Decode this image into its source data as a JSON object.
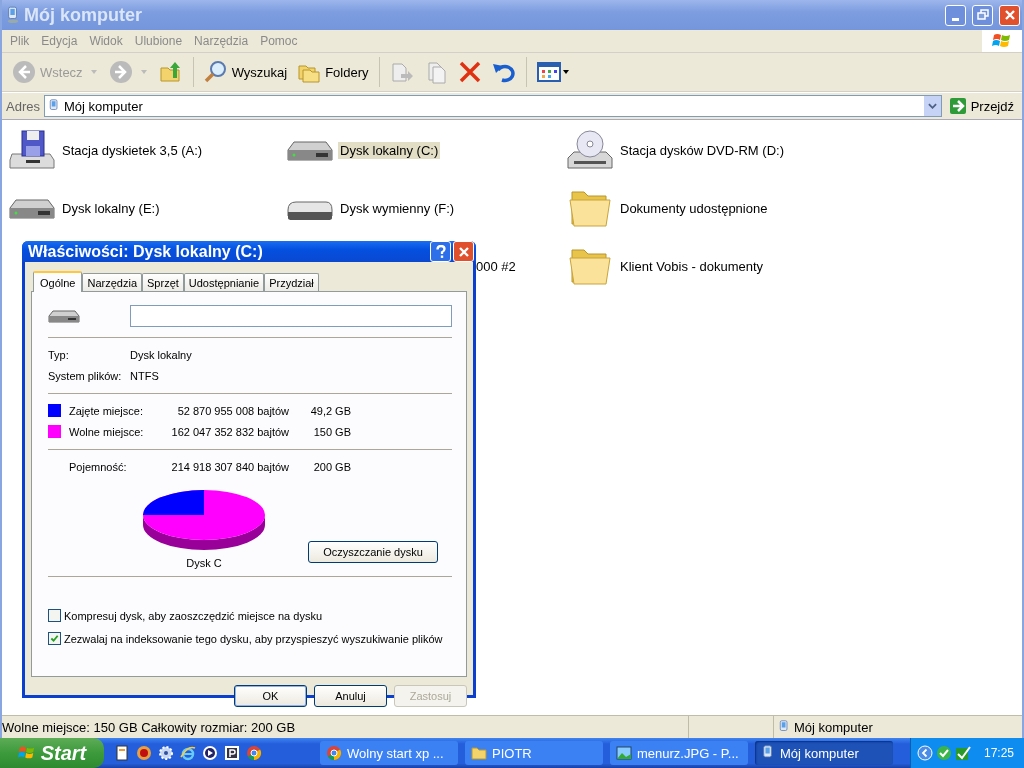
{
  "window": {
    "title": "Mój komputer"
  },
  "menu": [
    "Plik",
    "Edycja",
    "Widok",
    "Ulubione",
    "Narzędzia",
    "Pomoc"
  ],
  "toolbar": {
    "back": "Wstecz",
    "search": "Wyszukaj",
    "folders": "Foldery"
  },
  "address": {
    "label": "Adres",
    "value": "Mój komputer",
    "go": "Przejdź"
  },
  "items": [
    {
      "kind": "floppy",
      "label": "Stacja dyskietek 3,5 (A:)",
      "selected": false
    },
    {
      "kind": "disk",
      "label": "Dysk lokalny (C:)",
      "selected": true
    },
    {
      "kind": "dvd",
      "label": "Stacja dysków DVD-RM (D:)",
      "selected": false
    },
    {
      "kind": "disk",
      "label": "Dysk lokalny (E:)",
      "selected": false
    },
    {
      "kind": "removable",
      "label": "Dysk wymienny (F:)",
      "selected": false
    },
    {
      "kind": "folder",
      "label": "Dokumenty udostępnione",
      "selected": false
    },
    {
      "kind": "covered"
    },
    {
      "kind": "clipped",
      "label": "000 #2",
      "selected": false
    },
    {
      "kind": "folder",
      "label": "Klient Vobis - dokumenty",
      "selected": false
    }
  ],
  "dialog": {
    "title": "Właściwości: Dysk lokalny (C:)",
    "tabs": [
      {
        "label": "Ogólne",
        "selected": true
      },
      {
        "label": "Narzędzia",
        "selected": false
      },
      {
        "label": "Sprzęt",
        "selected": false
      },
      {
        "label": "Udostępnianie",
        "selected": false
      },
      {
        "label": "Przydział",
        "selected": false
      }
    ],
    "info": [
      {
        "label": "Typ:",
        "value": "Dysk lokalny"
      },
      {
        "label": "System plików:",
        "value": "NTFS"
      }
    ],
    "usage": [
      {
        "label": "Zajęte miejsce:",
        "color": "#0000ff",
        "bytes": "52 870 955 008 bajtów",
        "size": "49,2 GB"
      },
      {
        "label": "Wolne miejsce:",
        "color": "#ff00ff",
        "bytes": "162 047 352 832 bajtów",
        "size": "150 GB"
      }
    ],
    "capacity": {
      "label": "Pojemność:",
      "bytes": "214 918 307 840 bajtów",
      "size": "200 GB"
    },
    "chart_label": "Dysk C",
    "cleanup": "Oczyszczanie dysku",
    "options": [
      {
        "label": "Kompresuj dysk, aby zaoszczędzić miejsce na dysku",
        "checked": false
      },
      {
        "label": "Zezwalaj na indeksowanie tego dysku, aby przyspieszyć wyszukiwanie plików",
        "checked": true
      }
    ],
    "buttons": [
      {
        "label": "OK",
        "disabled": false
      },
      {
        "label": "Anuluj",
        "disabled": false
      },
      {
        "label": "Zastosuj",
        "disabled": true
      }
    ]
  },
  "status": {
    "text": "Wolne miejsce: 150 GB Całkowity rozmiar: 200 GB",
    "location": "Mój komputer"
  },
  "taskbar": {
    "start": "Start",
    "tasks": [
      {
        "kind": "browser",
        "label": "Wolny start xp ...",
        "selected": false
      },
      {
        "kind": "folder",
        "label": "PIOTR",
        "selected": false
      },
      {
        "kind": "image",
        "label": "menurz.JPG - P...",
        "selected": false
      },
      {
        "kind": "computer",
        "label": "Mój komputer",
        "selected": true
      }
    ],
    "clock": "17:25"
  }
}
